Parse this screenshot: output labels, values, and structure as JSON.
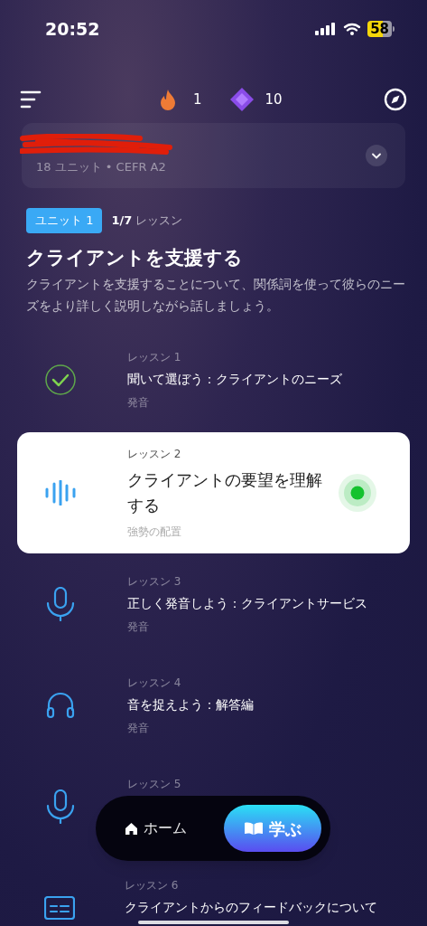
{
  "status_bar": {
    "time": "20:52",
    "battery": "58"
  },
  "top_bar": {
    "streak": "1",
    "gems": "10"
  },
  "course": {
    "subtitle": "18 ユニット • CEFR A2"
  },
  "unit": {
    "badge": "ユニット 1",
    "progress_count": "1/7",
    "progress_label": "レッスン",
    "title": "クライアントを支援する",
    "description": "クライアントを支援することについて、関係詞を使って彼らのニーズをより詳しく説明しながら話しましょう。"
  },
  "lessons": [
    {
      "kind": "check",
      "number": "レッスン 1",
      "title": "聞いて選ぼう：クライアントのニーズ",
      "category": "発音",
      "selected": false
    },
    {
      "kind": "wave",
      "number": "レッスン 2",
      "title": "クライアントの要望を理解する",
      "category": "強勢の配置",
      "selected": true
    },
    {
      "kind": "mic",
      "number": "レッスン 3",
      "title": "正しく発音しよう：クライアントサービス",
      "category": "発音",
      "selected": false
    },
    {
      "kind": "headphones",
      "number": "レッスン 4",
      "title": "音を捉えよう：解答編",
      "category": "発音",
      "selected": false
    },
    {
      "kind": "mic",
      "number": "レッスン 5",
      "selected": false
    },
    {
      "kind": "caption",
      "number": "レッスン 6",
      "title": "クライアントからのフィードバックについて",
      "selected": false
    }
  ],
  "nav": [
    {
      "kind": "home",
      "label": "ホーム",
      "selected": false
    },
    {
      "kind": "book",
      "label": "学ぶ",
      "selected": true
    }
  ]
}
